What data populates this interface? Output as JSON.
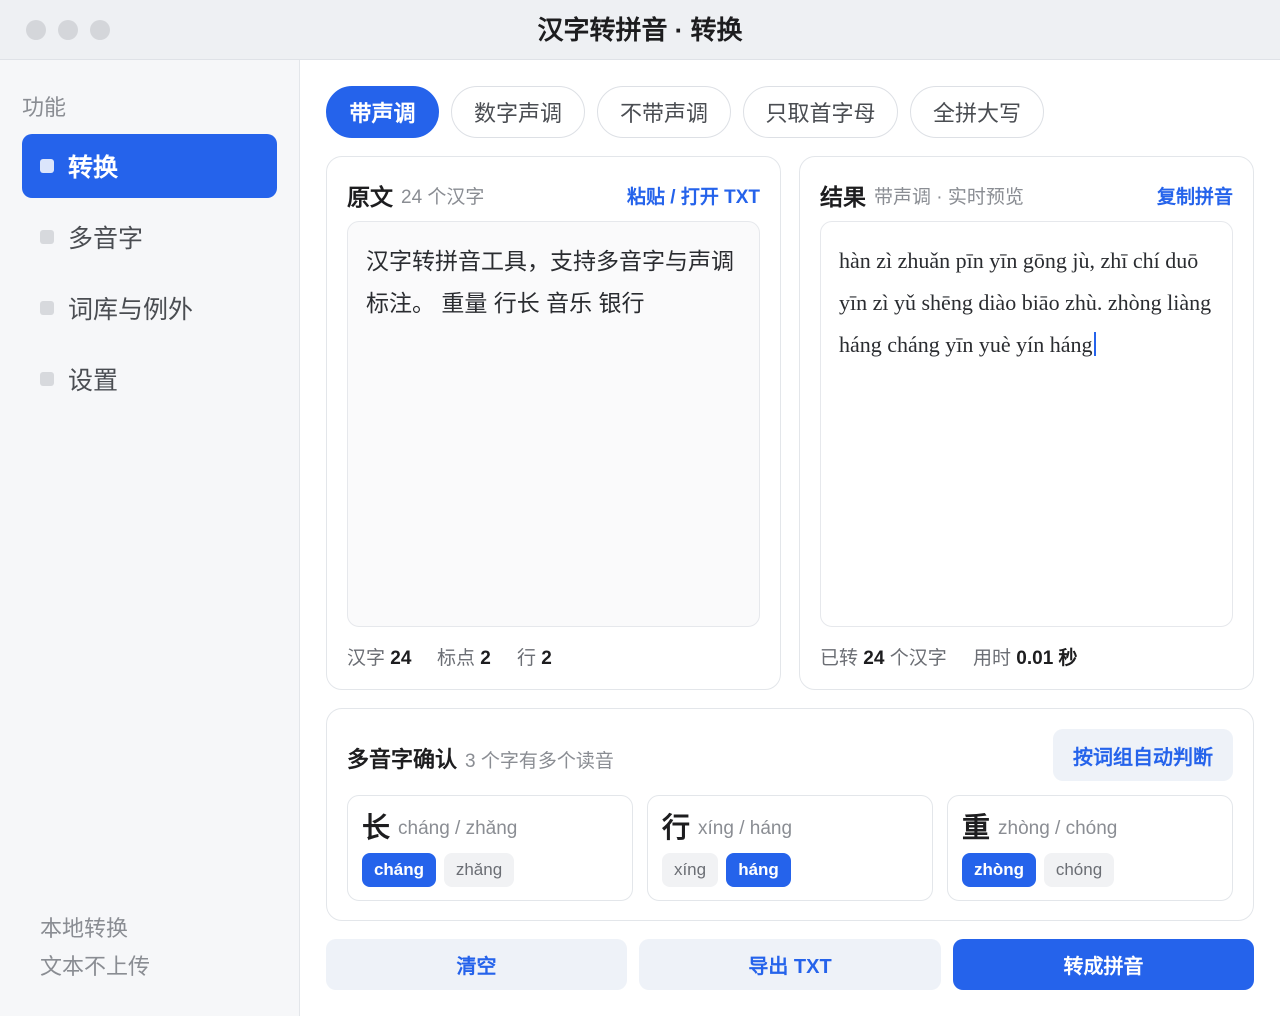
{
  "window": {
    "title": "汉字转拼音 · 转换"
  },
  "sidebar": {
    "section_label": "功能",
    "items": [
      {
        "label": "转换",
        "active": true
      },
      {
        "label": "多音字",
        "active": false
      },
      {
        "label": "词库与例外",
        "active": false
      },
      {
        "label": "设置",
        "active": false
      }
    ],
    "footer": [
      "本地转换",
      "文本不上传"
    ]
  },
  "tabs": [
    {
      "label": "带声调",
      "active": true
    },
    {
      "label": "数字声调",
      "active": false
    },
    {
      "label": "不带声调",
      "active": false
    },
    {
      "label": "只取首字母",
      "active": false
    },
    {
      "label": "全拼大写",
      "active": false
    }
  ],
  "source": {
    "title": "原文",
    "subtitle": "24 个汉字",
    "action": "粘贴 / 打开 TXT",
    "text": "汉字转拼音工具，支持多音字与声调标注。 重量 行长 音乐 银行",
    "stats": {
      "chars_label": "汉字",
      "chars_value": "24",
      "punct_label": "标点",
      "punct_value": "2",
      "lines_label": "行",
      "lines_value": "2"
    }
  },
  "result": {
    "title": "结果",
    "subtitle": "带声调 · 实时预览",
    "action": "复制拼音",
    "text": "hàn zì zhuǎn pīn yīn gōng jù, zhī chí duō yīn zì yǔ shēng diào biāo zhù. zhòng liàng háng cháng yīn yuè yín háng",
    "stats": {
      "converted_prefix": "已转",
      "converted_value": "24",
      "converted_suffix": "个汉字",
      "time_label": "用时",
      "time_value": "0.01 秒"
    }
  },
  "polyphone": {
    "title": "多音字确认",
    "subtitle": "3 个字有多个读音",
    "auto_button": "按词组自动判断",
    "items": [
      {
        "char": "长",
        "readings": "cháng / zhǎng",
        "options": [
          "cháng",
          "zhǎng"
        ],
        "selected": "cháng"
      },
      {
        "char": "行",
        "readings": "xíng / háng",
        "options": [
          "xíng",
          "háng"
        ],
        "selected": "háng"
      },
      {
        "char": "重",
        "readings": "zhòng / chóng",
        "options": [
          "zhòng",
          "chóng"
        ],
        "selected": "zhòng"
      }
    ]
  },
  "actions": {
    "clear": "清空",
    "export": "导出 TXT",
    "convert": "转成拼音"
  },
  "colors": {
    "accent": "#2563eb",
    "accent_soft": "#eef2f8",
    "sidebar_bg": "#f6f7f9"
  }
}
